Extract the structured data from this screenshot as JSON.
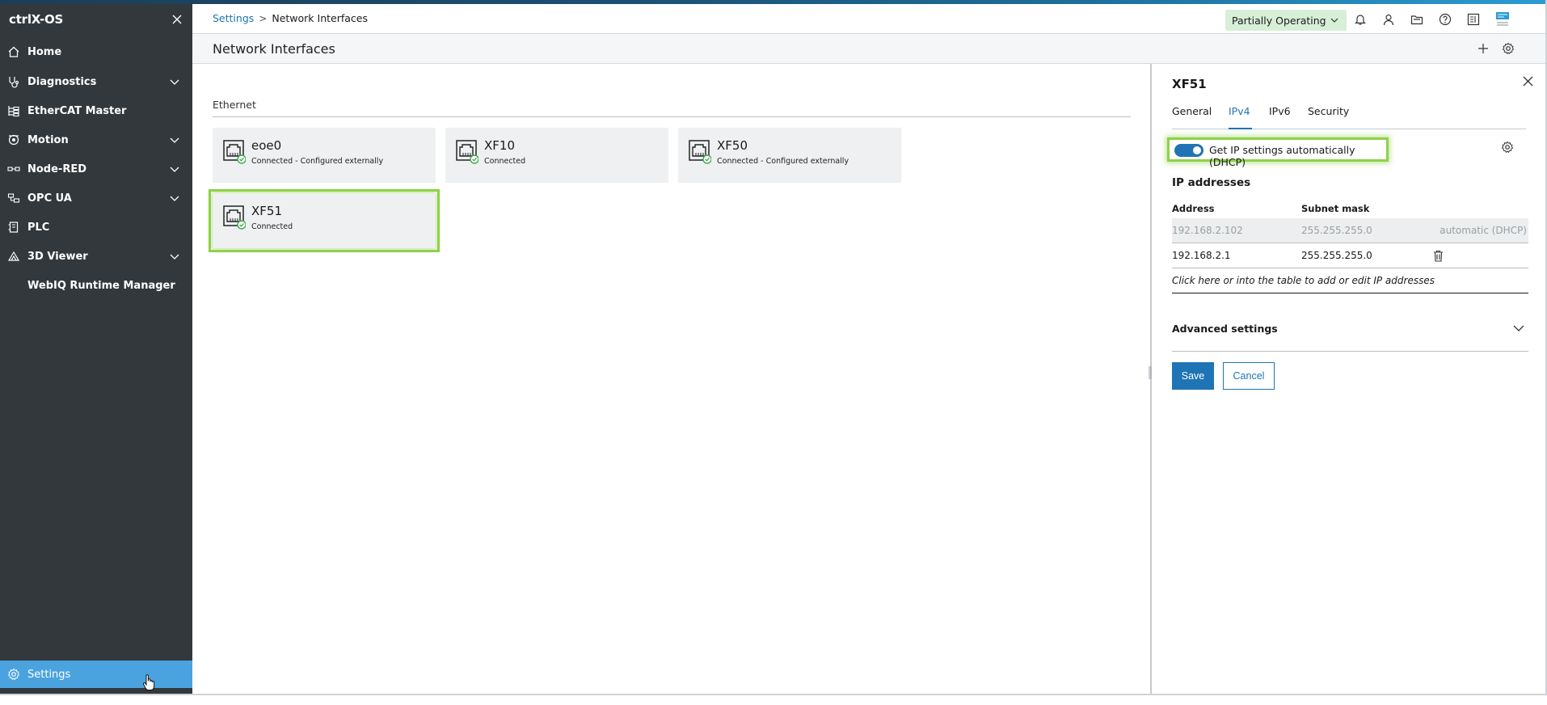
{
  "app": {
    "brand": "ctrlX-OS"
  },
  "sidebar": {
    "items": [
      {
        "label": "Home",
        "icon": "home-icon",
        "expandable": false
      },
      {
        "label": "Diagnostics",
        "icon": "diagnostics-icon",
        "expandable": true
      },
      {
        "label": "EtherCAT Master",
        "icon": "ethercat-icon",
        "expandable": false
      },
      {
        "label": "Motion",
        "icon": "motion-icon",
        "expandable": true
      },
      {
        "label": "Node-RED",
        "icon": "node-red-icon",
        "expandable": true
      },
      {
        "label": "OPC UA",
        "icon": "opc-ua-icon",
        "expandable": true
      },
      {
        "label": "PLC",
        "icon": "plc-icon",
        "expandable": false
      },
      {
        "label": "3D Viewer",
        "icon": "3d-viewer-icon",
        "expandable": true
      },
      {
        "label": "WebIQ Runtime Manager",
        "icon": "",
        "expandable": false
      }
    ],
    "settings": {
      "label": "Settings",
      "icon": "gear-icon",
      "active": true
    }
  },
  "header": {
    "breadcrumb": {
      "parent": "Settings",
      "separator": ">",
      "current": "Network Interfaces"
    },
    "status": "Partially Operating",
    "icons": [
      "bell-icon",
      "user-icon",
      "folder-icon",
      "help-icon",
      "app-switch-icon",
      "device-icon"
    ]
  },
  "page": {
    "title": "Network Interfaces",
    "toolbar_icons": [
      "add-icon",
      "settings-icon"
    ]
  },
  "section": {
    "label": "Ethernet"
  },
  "interfaces": [
    {
      "name": "eoe0",
      "status": "Connected - Configured externally",
      "selected": false
    },
    {
      "name": "XF10",
      "status": "Connected",
      "selected": false
    },
    {
      "name": "XF50",
      "status": "Connected - Configured externally",
      "selected": false
    },
    {
      "name": "XF51",
      "status": "Connected",
      "selected": true
    }
  ],
  "detail": {
    "title": "XF51",
    "tabs": [
      "General",
      "IPv4",
      "IPv6",
      "Security"
    ],
    "active_tab": "IPv4",
    "dhcp": {
      "label": "Get IP settings automatically (DHCP)",
      "enabled": true
    },
    "ip_heading": "IP addresses",
    "columns": {
      "address": "Address",
      "subnet": "Subnet mask"
    },
    "rows": [
      {
        "address": "192.168.2.102",
        "subnet": "255.255.255.0",
        "note": "automatic (DHCP)"
      },
      {
        "address": "192.168.2.1",
        "subnet": "255.255.255.0",
        "note": ""
      }
    ],
    "hint": "Click here or into the table to add or edit IP addresses",
    "advanced_label": "Advanced settings",
    "save_label": "Save",
    "cancel_label": "Cancel"
  },
  "colors": {
    "sidebar_bg": "#33383c",
    "accent": "#1f74b5",
    "active_nav": "#4aa3de",
    "highlight": "#8fd14a",
    "status_ok": "#3ea84a",
    "status_pill_bg": "#d7efd6"
  }
}
